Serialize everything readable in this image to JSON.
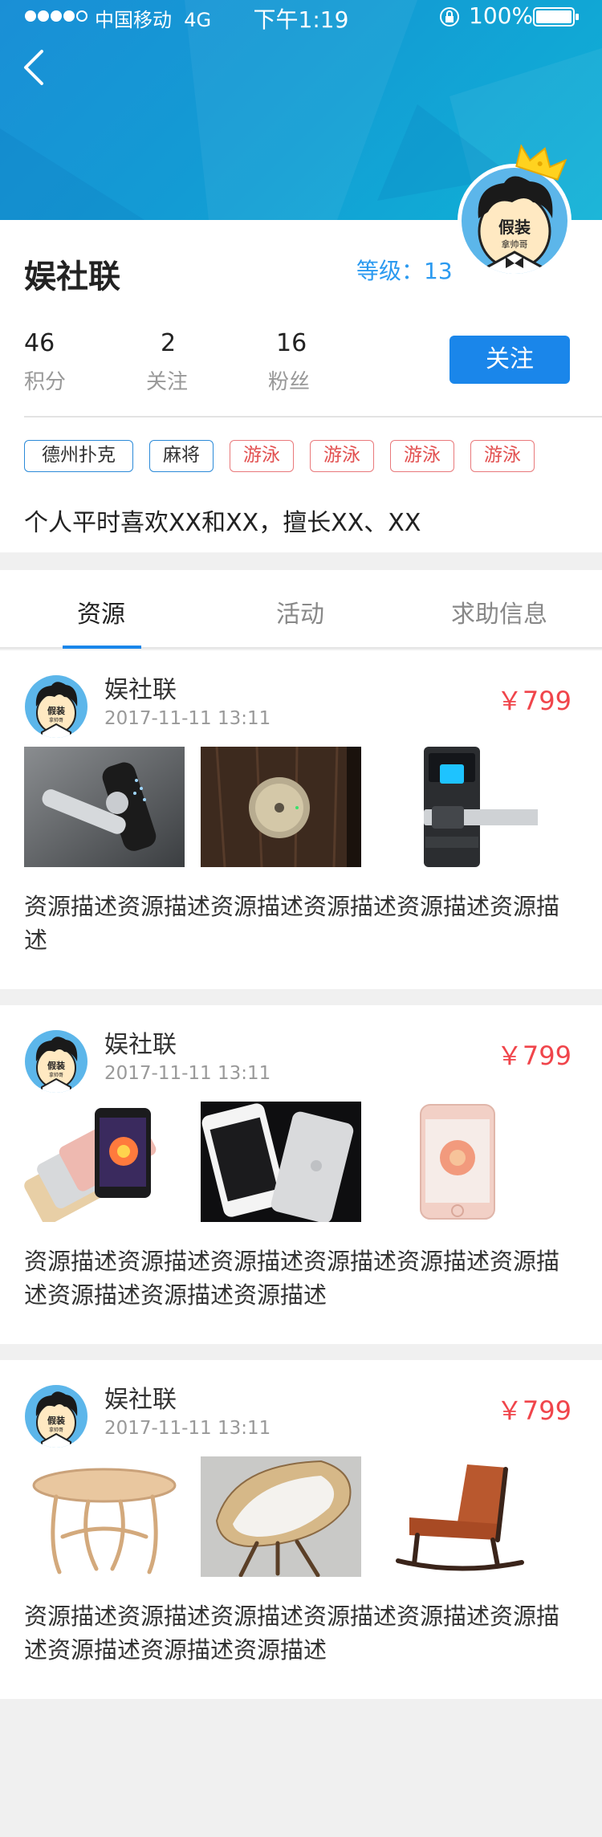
{
  "status_bar": {
    "carrier": "中国移动",
    "network": "4G",
    "time": "下午1:19",
    "battery": "100%"
  },
  "profile": {
    "name": "娱社联",
    "level_label": "等级：",
    "level_value": "13",
    "avatar_text": "假装",
    "avatar_subtext": "拿帅哥",
    "stats": [
      {
        "value": "46",
        "label": "积分"
      },
      {
        "value": "2",
        "label": "关注"
      },
      {
        "value": "16",
        "label": "粉丝"
      }
    ],
    "follow_label": "关注",
    "tags": [
      {
        "label": "德州扑克",
        "style": "blue"
      },
      {
        "label": "麻将",
        "style": "blue"
      },
      {
        "label": "游泳",
        "style": "red"
      },
      {
        "label": "游泳",
        "style": "red"
      },
      {
        "label": "游泳",
        "style": "red"
      },
      {
        "label": "游泳",
        "style": "red"
      }
    ],
    "bio": "个人平时喜欢XX和XX，擅长XX、XX"
  },
  "tabs": [
    {
      "label": "资源",
      "active": true
    },
    {
      "label": "活动",
      "active": false
    },
    {
      "label": "求助信息",
      "active": false
    }
  ],
  "cards": [
    {
      "name": "娱社联",
      "date": "2017-11-11  13:11",
      "price": "￥799",
      "images": [
        "smart-door-lock-silver",
        "round-brass-lock",
        "fingerprint-door-lock"
      ],
      "description": "资源描述资源描述资源描述资源描述资源描述资源描述"
    },
    {
      "name": "娱社联",
      "date": "2017-11-11  13:11",
      "price": "￥799",
      "images": [
        "iphone-se-colors",
        "iphone-5-black-white",
        "iphone-se-rose-gold"
      ],
      "description": "资源描述资源描述资源描述资源描述资源描述资源描述资源描述资源描述资源描述"
    },
    {
      "name": "娱社联",
      "date": "2017-11-11  13:11",
      "price": "￥799",
      "images": [
        "wooden-round-table",
        "wicker-lounge-chair",
        "leather-rocking-chair"
      ],
      "description": "资源描述资源描述资源描述资源描述资源描述资源描述资源描述资源描述资源描述"
    }
  ],
  "colors": {
    "accent": "#1a86ea",
    "price": "#f0454b",
    "tag_red": "#e9797b",
    "banner_start": "#1a8fd6",
    "banner_end": "#0fb2d6"
  }
}
